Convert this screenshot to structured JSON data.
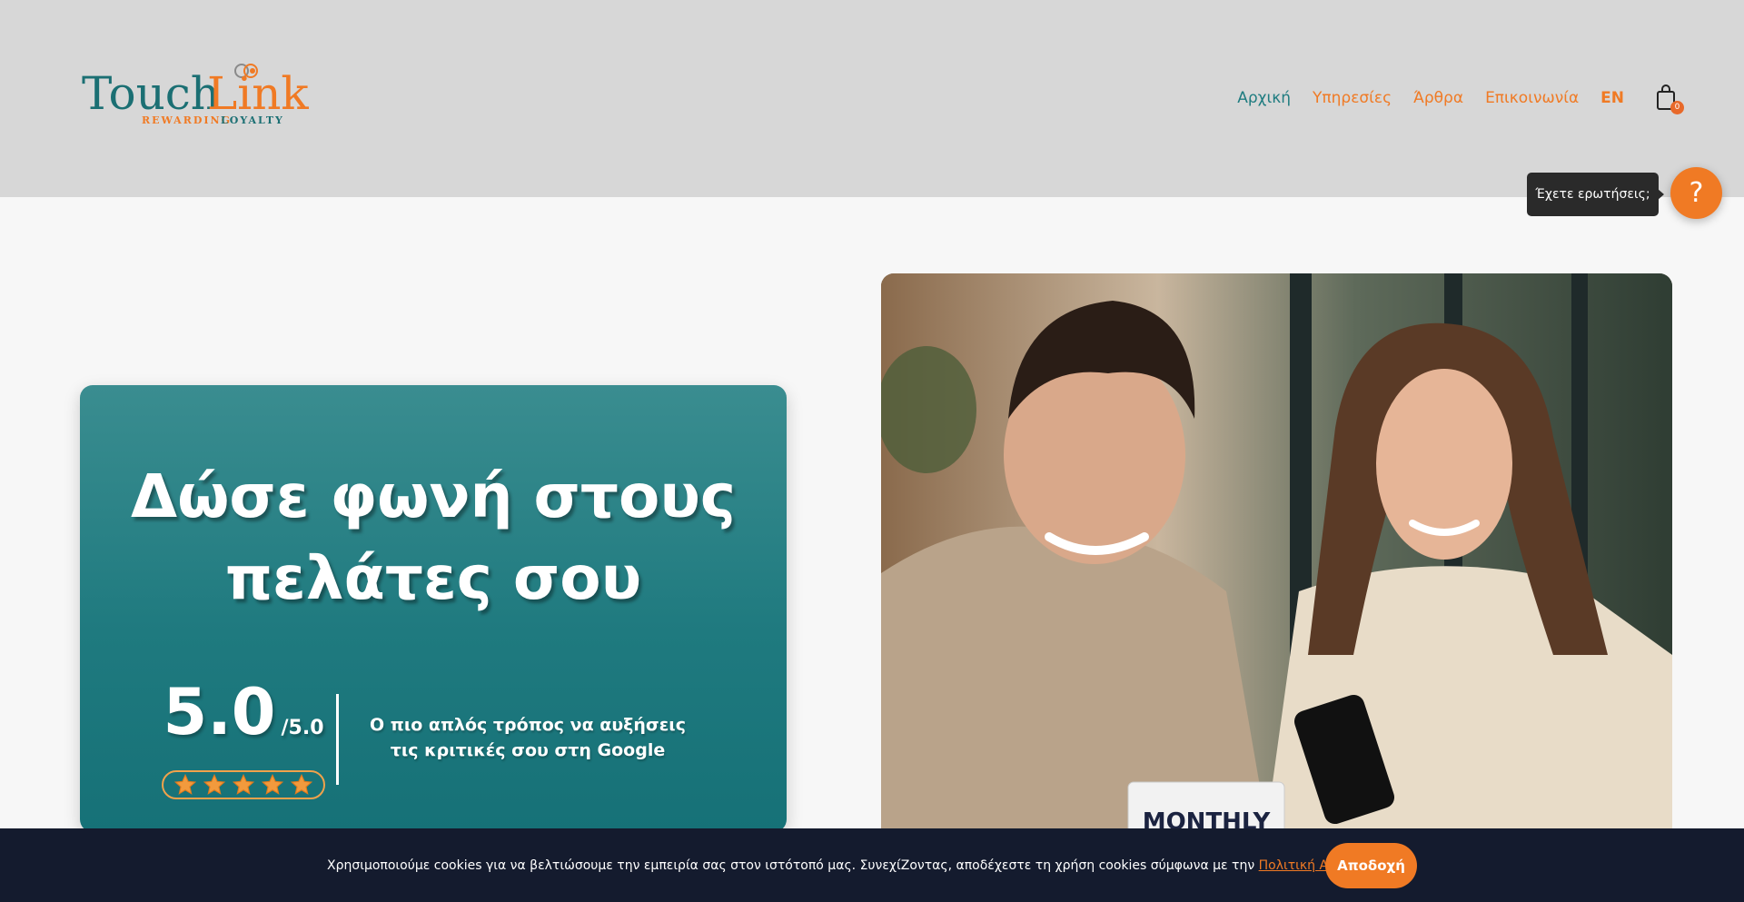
{
  "logo": {
    "brand_part1": "Touch",
    "brand_part2": "Link",
    "tagline_part1": "REWARDING",
    "tagline_part2": "LOYALTY"
  },
  "nav": {
    "items": [
      {
        "label": "Αρχική",
        "active": true
      },
      {
        "label": "Υπηρεσίες",
        "active": false
      },
      {
        "label": "Άρθρα",
        "active": false
      },
      {
        "label": "Επικοινωνία",
        "active": false
      },
      {
        "label": "EN",
        "active": false
      }
    ],
    "cart_count": "0"
  },
  "help": {
    "tooltip": "Έχετε ερωτήσεις;",
    "button_label": "?"
  },
  "hero": {
    "title_line1": "Δώσε φωνή στους",
    "title_line2": "πελάτες σου",
    "rating_value": "5.0",
    "rating_max": "/5.0",
    "stars": 5,
    "description_line1": "Ο πιο απλός τρόπος να αυξήσεις",
    "description_line2": "τις κριτικές σου στη Google",
    "image_sign_text": "MONTHLY"
  },
  "cookie": {
    "text": "Χρησιμοποιούμε cookies για να βελτιώσουμε την εμπειρία σας στον ιστότοπό μας. ΣυνεχίΖοντας, αποδέχεστε τη χρήση cookies σύμφωνα με την ",
    "link_label": "Πολιτική Απορρήτου",
    "text_end": ".",
    "accept_label": "Αποδοχή"
  },
  "colors": {
    "brand_orange": "#f07a24",
    "brand_teal": "#1f7c80",
    "header_bg": "#d7d7d7",
    "cookie_bg": "#141b2e"
  }
}
